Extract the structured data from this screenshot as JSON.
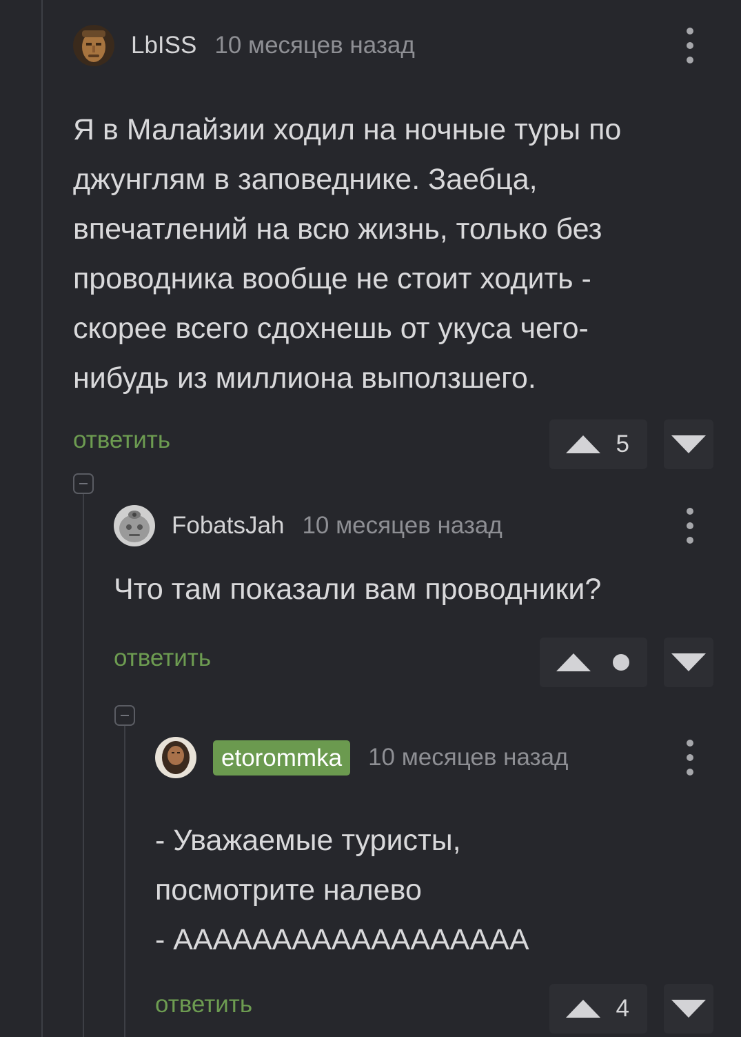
{
  "comments": [
    {
      "avatar_icon": "face-avatar-icon",
      "username": "LbISS",
      "timestamp": "10 месяцев назад",
      "text": "Я в Малайзии ходил на ночные туры по\nджунглям в заповеднике. Заебца,\nвпечатлений на всю жизнь, только без\nпроводника вообще не стоит ходить -\nскорее всего сдохнешь от укуса чего-\nнибудь из миллиона выползшего.",
      "reply_label": "ответить",
      "rating": "5"
    },
    {
      "avatar_icon": "stone-face-avatar-icon",
      "username": "FobatsJah",
      "timestamp": "10 месяцев назад",
      "text": "Что там показали вам проводники?",
      "reply_label": "ответить",
      "rating": "•"
    },
    {
      "avatar_icon": "bearded-man-avatar-icon",
      "username": "etorommka",
      "username_badge_color": "#6b9a4f",
      "timestamp": "10 месяцев назад",
      "text": "- Уважаемые туристы,\nпосмотрите налево\n- АААААААААААААААААА",
      "reply_label": "ответить",
      "rating": "4"
    }
  ],
  "colors": {
    "background": "#26272c",
    "accent_green": "#6d9c51",
    "vote_button_bg": "#2d2e33",
    "thread_line": "#3d3f45"
  }
}
